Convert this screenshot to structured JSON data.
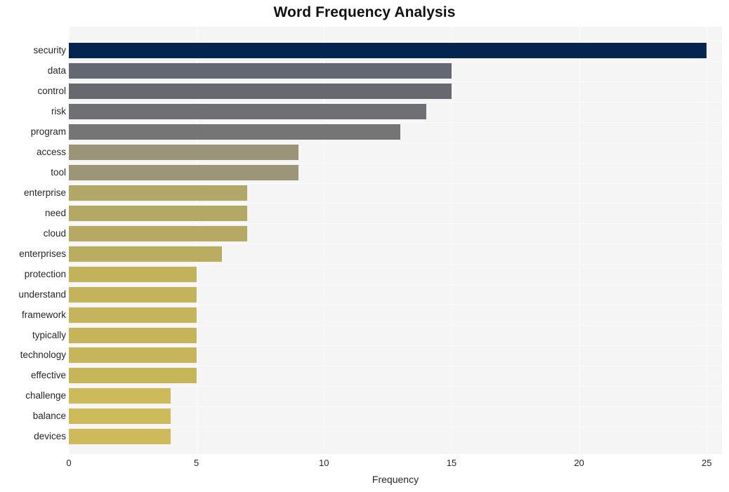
{
  "chart_data": {
    "type": "bar",
    "orientation": "horizontal",
    "title": "Word Frequency Analysis",
    "xlabel": "Frequency",
    "ylabel": "",
    "xlim": [
      0,
      25.6
    ],
    "xticks": [
      0,
      5,
      10,
      15,
      20,
      25
    ],
    "grid": "vertical-only",
    "legend": "none",
    "categories": [
      "security",
      "data",
      "control",
      "risk",
      "program",
      "access",
      "tool",
      "enterprise",
      "need",
      "cloud",
      "enterprises",
      "protection",
      "understand",
      "framework",
      "typically",
      "technology",
      "effective",
      "challenge",
      "balance",
      "devices"
    ],
    "values": [
      25,
      15,
      15,
      14,
      13,
      9,
      9,
      7,
      7,
      7,
      6,
      5,
      5,
      5,
      5,
      5,
      5,
      4,
      4,
      4
    ],
    "bar_colors": [
      "#04254f",
      "#646873",
      "#67696e",
      "#6e7073",
      "#757575",
      "#9c9478",
      "#9d9578",
      "#b3a767",
      "#b4a866",
      "#b5a964",
      "#bbad60",
      "#c2b25c",
      "#c3b35b",
      "#c4b45b",
      "#c5b45a",
      "#c6b55a",
      "#c7b659",
      "#ccba5b",
      "#cdba5b",
      "#ceba5b"
    ],
    "plot_background": "#f5f5f6",
    "gridline_color": "#ffffff",
    "page_background": "#ffffff"
  },
  "chart": {
    "title": "Word Frequency Analysis",
    "x_axis_label": "Frequency"
  }
}
